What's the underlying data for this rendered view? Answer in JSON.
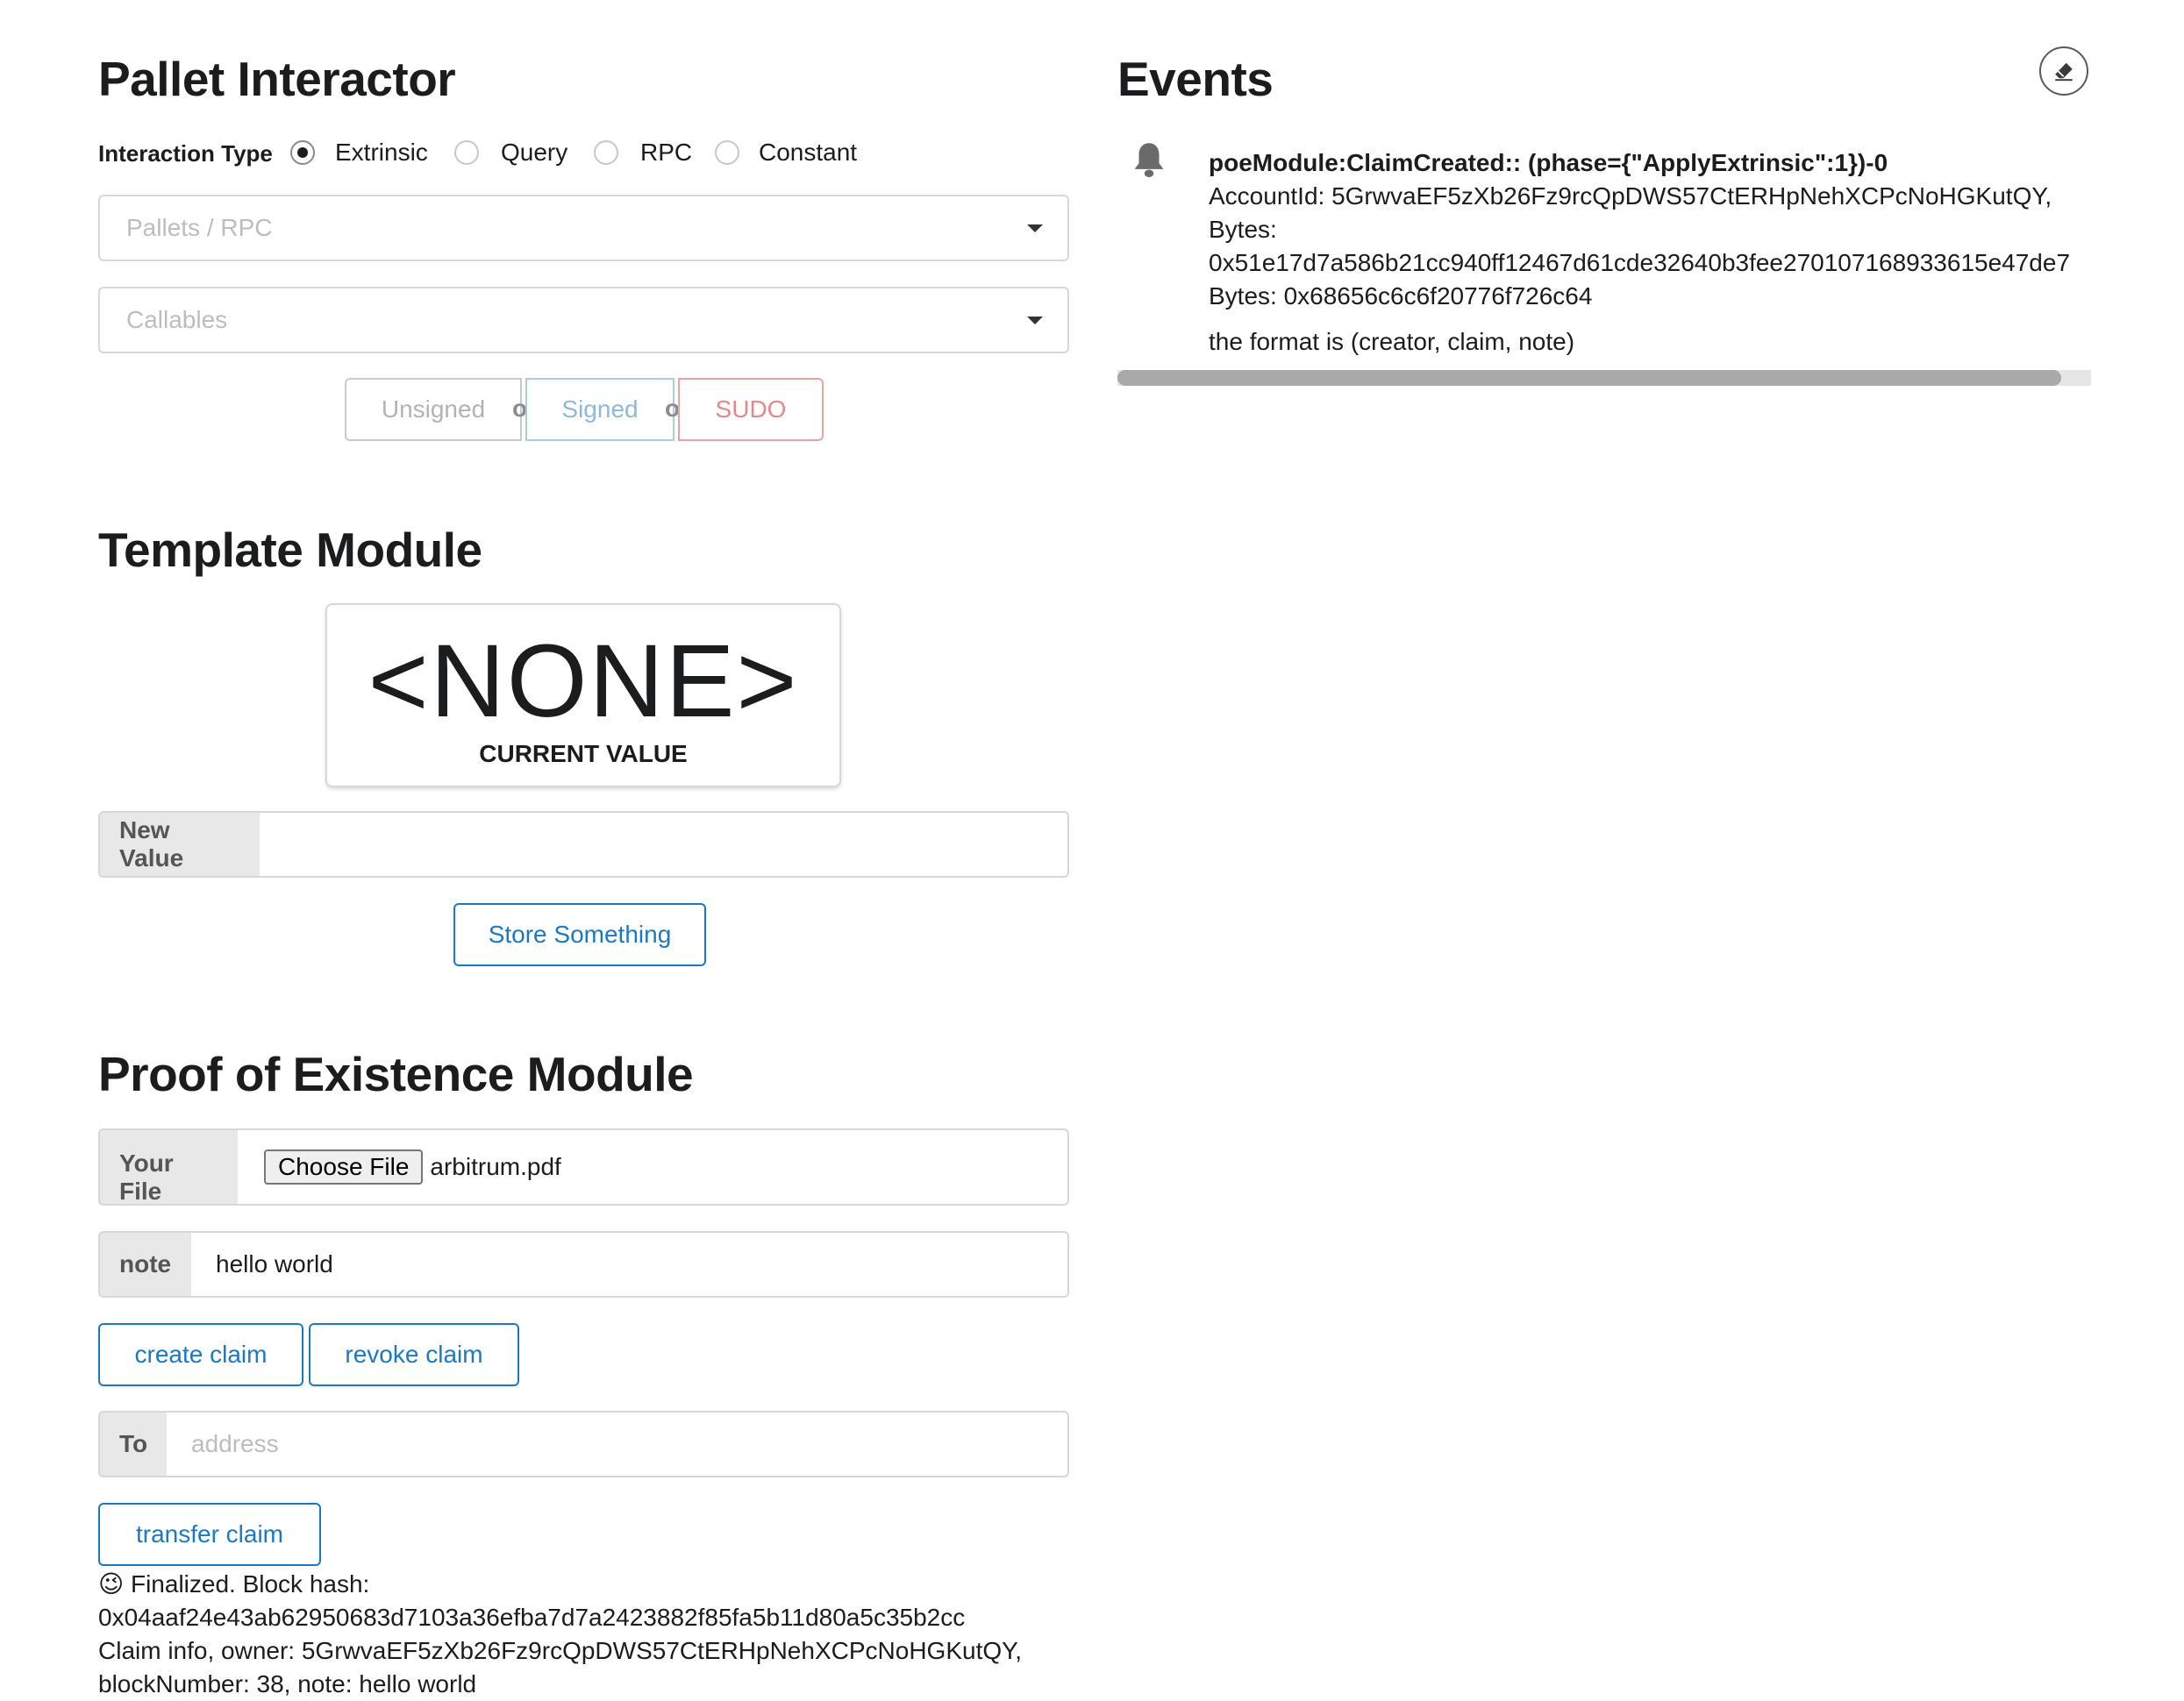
{
  "pallet": {
    "title": "Pallet Interactor",
    "interaction_type_label": "Interaction Type",
    "options": [
      "Extrinsic",
      "Query",
      "RPC",
      "Constant"
    ],
    "selected": "Extrinsic",
    "pallets_placeholder": "Pallets / RPC",
    "callables_placeholder": "Callables",
    "unsigned": "Unsigned",
    "signed": "Signed",
    "sudo": "SUDO",
    "or": "or"
  },
  "template": {
    "title": "Template Module",
    "current_value": "<NONE>",
    "current_value_caption": "CURRENT VALUE",
    "new_value_label": "New Value",
    "new_value": "",
    "store_button": "Store Something"
  },
  "poe": {
    "title": "Proof of Existence Module",
    "file_label": "Your File",
    "choose_file": "Choose File",
    "file_name": "arbitrum.pdf",
    "note_label": "note",
    "note_value": "hello world",
    "create_claim": "create claim",
    "revoke_claim": "revoke claim",
    "to_label": "To",
    "to_placeholder": "address",
    "transfer_claim": "transfer claim",
    "status_line1": "😉  Finalized. Block hash:",
    "status_line2": "0x04aaf24e43ab62950683d7103a36efba7d7a2423882f85fa5b11d80a5c35b2cc",
    "status_line3": "Claim info, owner: 5GrwvaEF5zXb26Fz9rcQpDWS57CtERHpNehXCPcNoHGKutQY,",
    "status_line4": "blockNumber: 38, note: hello world"
  },
  "events": {
    "title": "Events",
    "items": [
      {
        "header": "poeModule:ClaimCreated:: (phase={\"ApplyExtrinsic\":1})-0",
        "line1": "AccountId: 5GrwvaEF5zXb26Fz9rcQpDWS57CtERHpNehXCPcNoHGKutQY,",
        "line2": "Bytes:",
        "line3": "0x51e17d7a586b21cc940ff12467d61cde32640b3fee270107168933615e47de7",
        "line4": "Bytes: 0x68656c6c6f20776f726c64",
        "note": "the format is (creator, claim, note)"
      }
    ]
  }
}
